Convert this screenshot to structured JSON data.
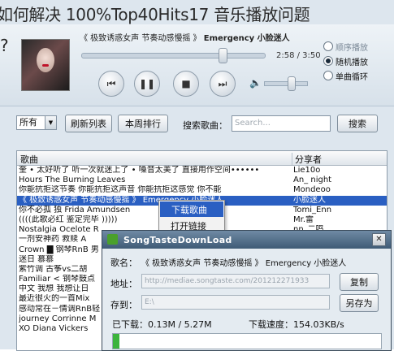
{
  "page_title": {
    "line1": "如何解决 100%Top40Hits17 音乐播放问题",
    "line2": "?"
  },
  "player": {
    "now_playing_prefix": "《 极致诱惑女声 节奏动感慢摇 》",
    "now_playing_artist": "Emergency 小脸迷人",
    "time": "2:58 / 3:50",
    "progress_fraction": 0.77,
    "volume_fraction": 0.62,
    "controls": {
      "prev": "⏮",
      "pause": "❚❚",
      "stop": "■",
      "next": "⏭"
    },
    "modes": [
      {
        "label": "顺序播放",
        "selected": false
      },
      {
        "label": "随机播放",
        "selected": true
      },
      {
        "label": "单曲循环",
        "selected": false
      }
    ]
  },
  "toolbar": {
    "filter_value": "所有",
    "refresh_label": "刷新列表",
    "weekly_label": "本周排行",
    "search_label": "搜索歌曲：",
    "search_placeholder": "Search...",
    "search_button": "搜索"
  },
  "list": {
    "col_song": "歌曲",
    "col_sharer": "分享者",
    "rows": [
      {
        "title": "奎 • 太好听了 听一次就迷上了 • 嗓音太美了 直接用作空间••••••",
        "sharer": "Lie10o"
      },
      {
        "title": "Hours The Burning Leaves",
        "sharer": "An_ night"
      },
      {
        "title": "你能抗拒这节奏 你能抗拒这声音 你能抗拒这感觉 你不能",
        "sharer": "Mondeoo"
      },
      {
        "title": "《 极致诱惑女声 节奏动感慢摇 》 Emergency 小脸迷人",
        "sharer": "小脸迷人",
        "selected": true
      },
      {
        "title": "你不必孤 独 Frida Amundsen",
        "sharer": "Tomi_Enn"
      },
      {
        "title": "((((此歌必红 鉴定完毕 )))))",
        "sharer": "Mr.雷"
      },
      {
        "title": "Nostalgia Ocelote R",
        "sharer": "nn_二鸣"
      },
      {
        "title": "一剂安神药 救赎 A",
        "sharer": ""
      },
      {
        "title": "Crown █ 钢琴RnB 男",
        "sharer": ""
      },
      {
        "title": "迷日 慕慕",
        "sharer": ""
      },
      {
        "title": "紫竹调 古筝vs二胡",
        "sharer": ""
      },
      {
        "title": "Familiar < 钢琴鼓点",
        "sharer": ""
      },
      {
        "title": "中文 我想 我想让日",
        "sharer": ""
      },
      {
        "title": "最近很火的一首Mix",
        "sharer": ""
      },
      {
        "title": "感动常在－情调RnB轻",
        "sharer": ""
      },
      {
        "title": "journey Corrinne M",
        "sharer": ""
      },
      {
        "title": "XO Diana Vickers",
        "sharer": ""
      }
    ]
  },
  "context_menu": {
    "items": [
      "下载歌曲",
      "打开链接"
    ]
  },
  "dialog": {
    "title": "SongTasteDownLoad",
    "song_label": "歌名：",
    "song_value": "《 极致诱惑女声 节奏动感慢摇 》 Emergency 小脸迷人",
    "url_label": "地址：",
    "url_value": "http://mediae.songtaste.com/201212271933",
    "copy_button": "复制",
    "save_label": "存到：",
    "save_value": "E:\\",
    "save_as_button": "另存为",
    "size_label": "已下载：0.13M / 5.27M",
    "speed_label": "下载速度：154.03KB/s",
    "progress_fraction": 0.025
  }
}
